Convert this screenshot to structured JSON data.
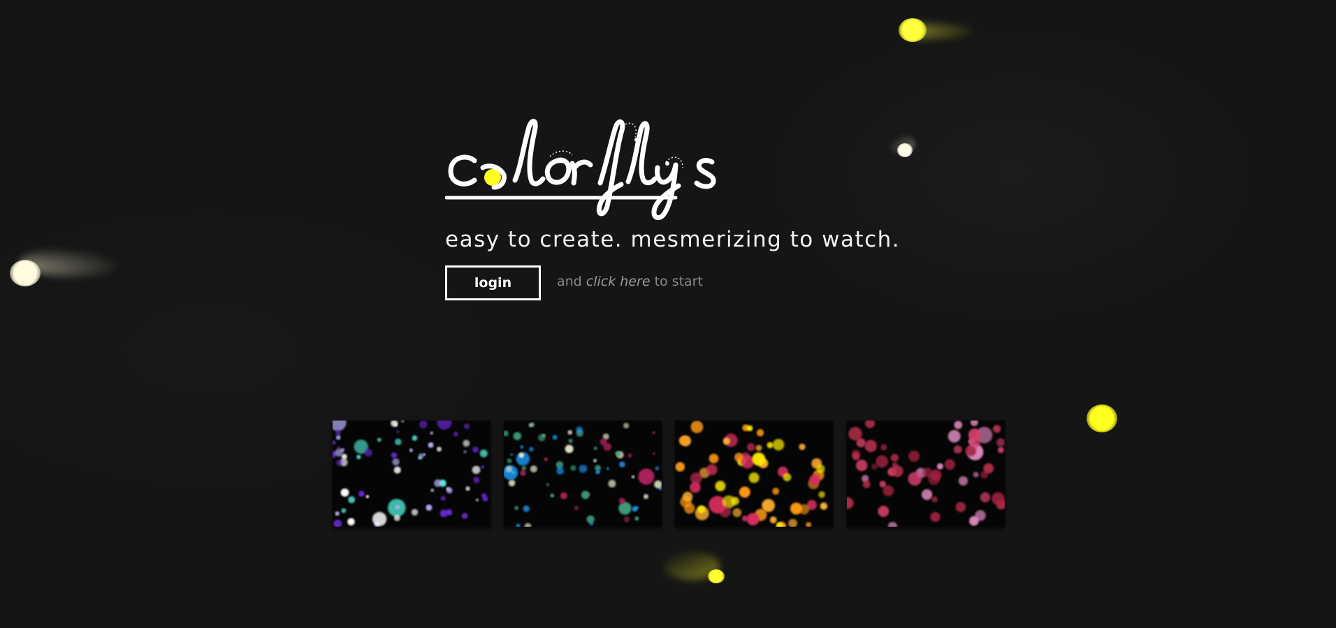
{
  "app": {
    "logo_text": "colorflys",
    "tagline": "easy to create. mesmerizing to watch."
  },
  "actions": {
    "login_label": "login",
    "hint_prefix": "and",
    "hint_link": "click here",
    "hint_suffix": "to start"
  },
  "colors": {
    "background": "#151515",
    "text": "#f2f2f2",
    "hint": "#8a8a8a",
    "firefly_yellow": "#ffff33",
    "firefly_cream": "#fffbe0"
  },
  "gallery": [
    {
      "name": "purple-cyan",
      "palette": [
        "#b9b3ff",
        "#6a2bd6",
        "#4ff0d8",
        "#ffffff"
      ]
    },
    {
      "name": "blue-cream-magenta",
      "palette": [
        "#1fa0ff",
        "#e8e6c8",
        "#b3245f",
        "#3fa886"
      ]
    },
    {
      "name": "yellow-orange",
      "palette": [
        "#ff9a14",
        "#ffee00",
        "#d62f5f",
        "#ffb030"
      ]
    },
    {
      "name": "pink-crimson",
      "palette": [
        "#d6426c",
        "#a3233f",
        "#e08ac0",
        "#c03050"
      ]
    }
  ]
}
